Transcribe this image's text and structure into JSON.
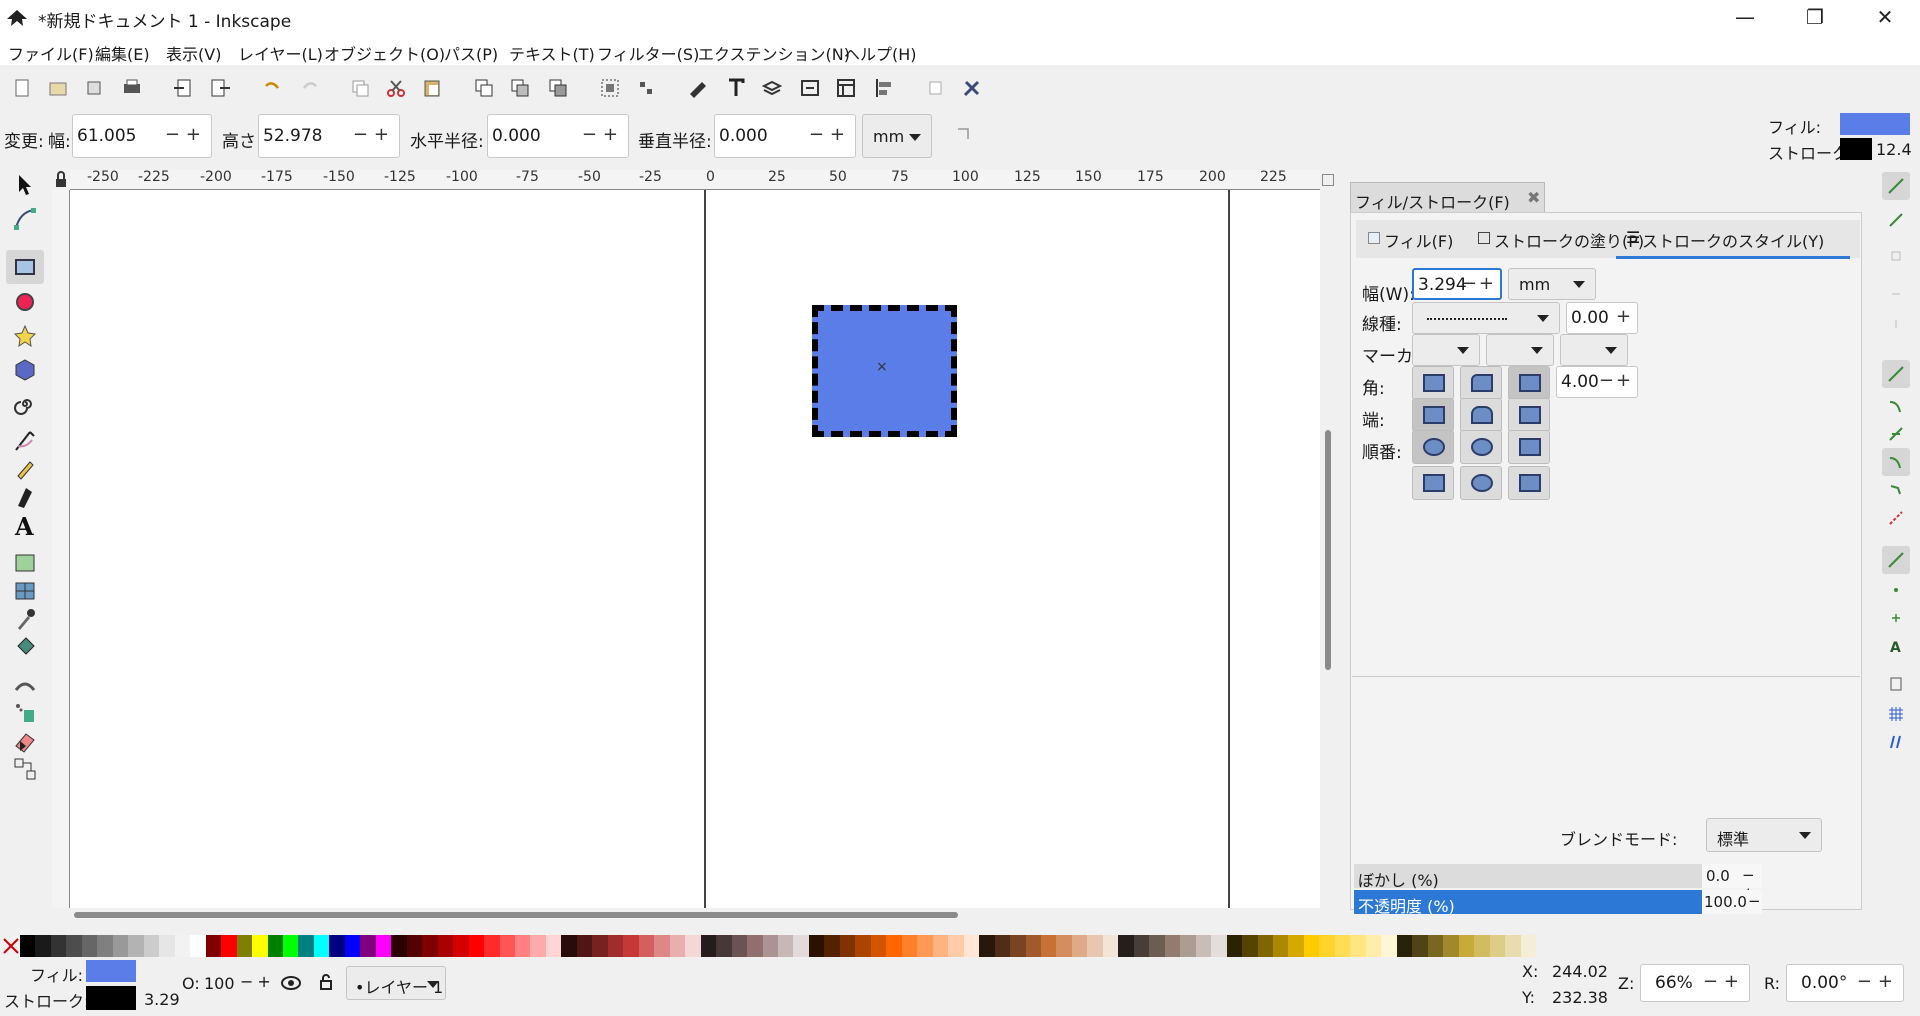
{
  "window": {
    "title": "*新規ドキュメント 1 - Inkscape",
    "min": "—",
    "restore": "❐",
    "close": "✕"
  },
  "menu": [
    "ファイル(F)",
    "編集(E)",
    "表示(V)",
    "レイヤー(L)",
    "オブジェクト(O)",
    "パス(P)",
    "テキスト(T)",
    "フィルター(S)",
    "エクステンション(N)",
    "ヘルプ(H)"
  ],
  "controls": {
    "change_label": "変更:",
    "width_label": "幅:",
    "width_value": "61.005",
    "height_label": "高さ:",
    "height_value": "52.978",
    "rx_label": "水平半径:",
    "rx_value": "0.000",
    "ry_label": "垂直半径:",
    "ry_value": "0.000",
    "unit": "mm",
    "fill_label": "フィル:",
    "stroke_label": "ストローク:",
    "stroke_width": "12.4",
    "fill_color": "#5b7de8",
    "stroke_color": "#000000"
  },
  "ruler_ticks": [
    "-250",
    "-225",
    "-200",
    "-175",
    "-150",
    "-125",
    "-100",
    "-75",
    "-50",
    "-25",
    "0",
    "25",
    "50",
    "75",
    "100",
    "125",
    "150",
    "175",
    "200",
    "225"
  ],
  "panel": {
    "title": "フィル/ストローク(F)",
    "tabs": [
      "フィル(F)",
      "ストロークの塗り(P)",
      "ストロークのスタイル(Y)"
    ],
    "width_label": "幅(W):",
    "width_value": "3.294",
    "width_unit": "mm",
    "dash_label": "線種:",
    "dash_offset": "0.00",
    "marker_label": "マーカー:",
    "join_label": "角:",
    "miter_value": "4.00",
    "cap_label": "端:",
    "order_label": "順番:",
    "blend_label": "ブレンドモード:",
    "blend_value": "標準",
    "blur_label": "ぼかし (%)",
    "blur_value": "0.0",
    "opacity_label": "不透明度 (%)",
    "opacity_value": "100.0"
  },
  "status": {
    "fill_label": "フィル:",
    "stroke_label": "ストローク:",
    "stroke_width": "3.29",
    "opacity_label": "O:",
    "opacity_value": "100",
    "layer": "•レイヤー 1",
    "x_label": "X:",
    "x_value": "244.02",
    "y_label": "Y:",
    "y_value": "232.38",
    "zoom_label": "Z:",
    "zoom_value": "66%",
    "rotate_label": "R:",
    "rotate_value": "0.00°"
  }
}
